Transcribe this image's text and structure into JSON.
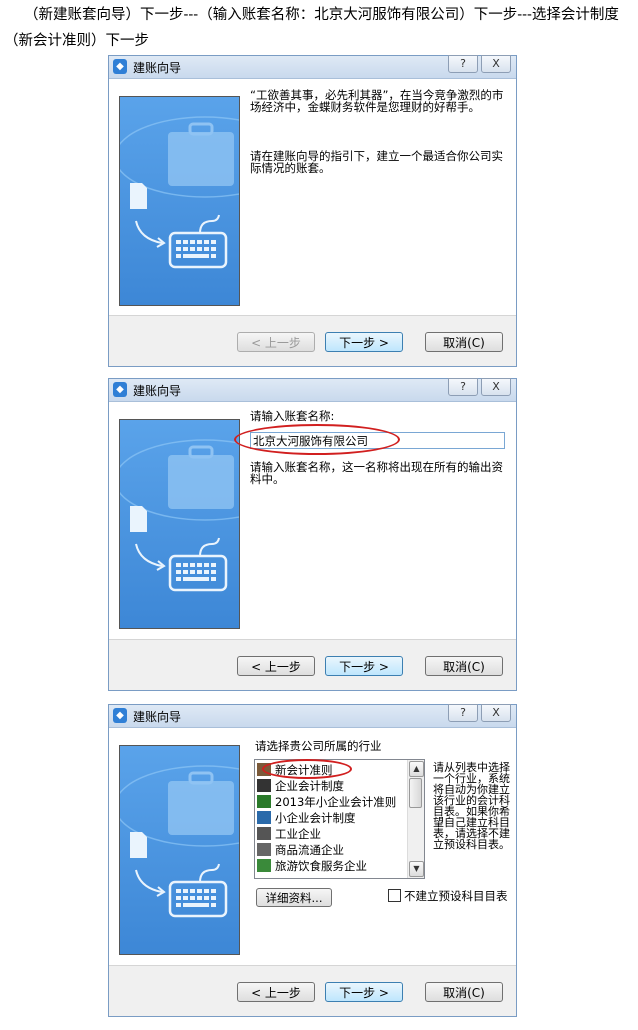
{
  "caption": "（新建账套向导）下一步---（输入账套名称：北京大河服饰有限公司）下一步---选择会计制度（新会计准则）下一步",
  "dialog_title": "建账向导",
  "titlebar_icon": "app-icon",
  "help_glyph": "?",
  "close_glyph": "X",
  "buttons": {
    "prev": "< 上一步",
    "next": "下一步 >",
    "cancel": "取消(C)"
  },
  "step1": {
    "para1": "“工欲善其事，必先利其器”，在当今竞争激烈的市场经济中，金蝶财务软件是您理财的好帮手。",
    "para2": "请在建账向导的指引下，建立一个最适合你公司实际情况的账套。"
  },
  "step2": {
    "label": "请输入账套名称:",
    "value": "北京大河服饰有限公司",
    "hint": "请输入账套名称，这一名称将出现在所有的输出资料中。"
  },
  "step3": {
    "label": "请选择贵公司所属的行业",
    "industries": [
      "新会计准则",
      "企业会计制度",
      "2013年小企业会计准则",
      "小企业会计制度",
      "工业企业",
      "商品流通企业",
      "旅游饮食服务企业"
    ],
    "hint": "请从列表中选择一个行业，系统将自动为你建立该行业的会计科目表。如果你希望自己建立科目表，请选择不建立预设科目表。",
    "detail_button": "详细资料...",
    "checkbox_label": "不建立预设科目目表"
  },
  "colors": {
    "annotation": "#d11f1f",
    "banner": "#3d87d6"
  }
}
